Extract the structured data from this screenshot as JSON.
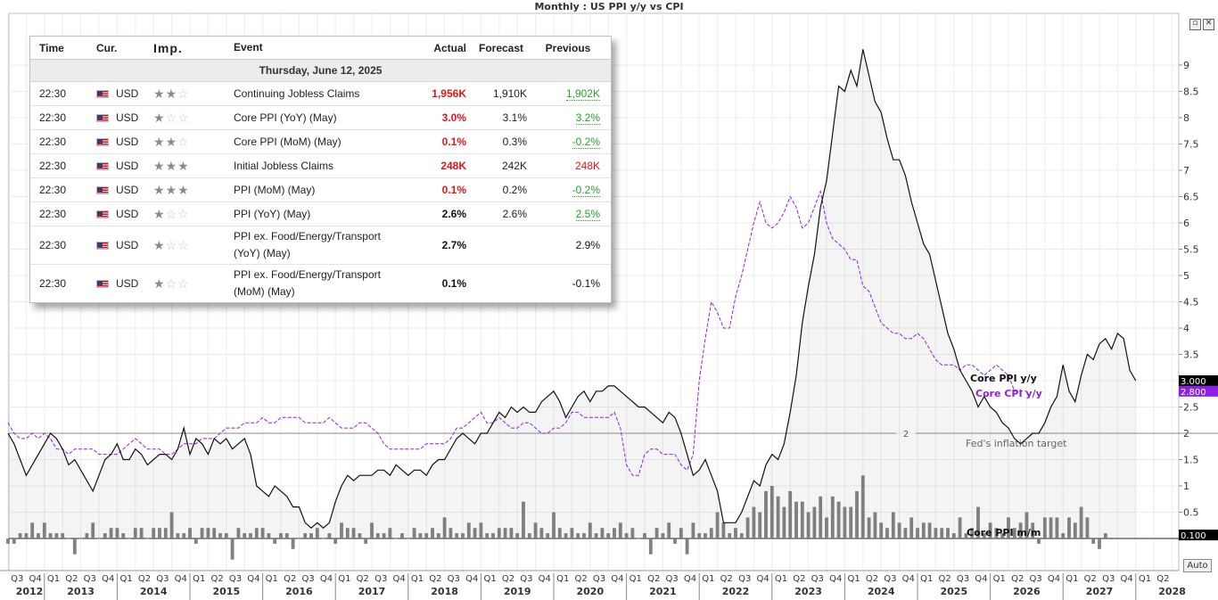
{
  "title": "Monthly : US PPI y/y vs CPI",
  "auto_label": "Auto",
  "calendar": {
    "headers": {
      "time": "Time",
      "cur": "Cur.",
      "imp": "Imp.",
      "event": "Event",
      "actual": "Actual",
      "forecast": "Forecast",
      "previous": "Previous"
    },
    "date": "Thursday, June 12, 2025",
    "rows": [
      {
        "time": "22:30",
        "cur": "USD",
        "stars": 2,
        "event": [
          "Continuing Jobless Claims"
        ],
        "actual": "1,956K",
        "actual_color": "red",
        "forecast": "1,910K",
        "previous": "1,902K",
        "previous_color": "green"
      },
      {
        "time": "22:30",
        "cur": "USD",
        "stars": 1,
        "event": [
          "Core PPI (YoY) (May)"
        ],
        "actual": "3.0%",
        "actual_color": "red",
        "forecast": "3.1%",
        "previous": "3.2%",
        "previous_color": "green"
      },
      {
        "time": "22:30",
        "cur": "USD",
        "stars": 2,
        "event": [
          "Core PPI (MoM) (May)"
        ],
        "actual": "0.1%",
        "actual_color": "red",
        "forecast": "0.3%",
        "previous": "-0.2%",
        "previous_color": "green"
      },
      {
        "time": "22:30",
        "cur": "USD",
        "stars": 3,
        "event": [
          "Initial Jobless Claims"
        ],
        "actual": "248K",
        "actual_color": "red",
        "forecast": "242K",
        "previous": "248K",
        "previous_color": "red"
      },
      {
        "time": "22:30",
        "cur": "USD",
        "stars": 3,
        "event": [
          "PPI (MoM) (May)"
        ],
        "actual": "0.1%",
        "actual_color": "red",
        "forecast": "0.2%",
        "previous": "-0.2%",
        "previous_color": "green"
      },
      {
        "time": "22:30",
        "cur": "USD",
        "stars": 1,
        "event": [
          "PPI (YoY) (May)"
        ],
        "actual": "2.6%",
        "actual_color": "black",
        "forecast": "2.6%",
        "previous": "2.5%",
        "previous_color": "green"
      },
      {
        "time": "22:30",
        "cur": "USD",
        "stars": 1,
        "event": [
          "PPI ex. Food/Energy/Transport",
          "(YoY) (May)"
        ],
        "actual": "2.7%",
        "actual_color": "black",
        "forecast": "",
        "previous": "2.9%",
        "previous_color": "black"
      },
      {
        "time": "22:30",
        "cur": "USD",
        "stars": 1,
        "event": [
          "PPI ex. Food/Energy/Transport",
          "(MoM) (May)"
        ],
        "actual": "0.1%",
        "actual_color": "black",
        "forecast": "",
        "previous": "-0.1%",
        "previous_color": "black"
      }
    ]
  },
  "chart_data": {
    "type": "line",
    "title": "Monthly : US PPI y/y vs CPI",
    "ylim": [
      -0.6,
      9.9
    ],
    "yticks": [
      "0.5",
      "1",
      "1.5",
      "2",
      "2.5",
      "3",
      "3.5",
      "4",
      "4.5",
      "5",
      "5.5",
      "6",
      "6.5",
      "7",
      "7.5",
      "8",
      "8.5",
      "9"
    ],
    "yticks_values": [
      0.5,
      1,
      1.5,
      2,
      2.5,
      3,
      3.5,
      4,
      4.5,
      5,
      5.5,
      6,
      6.5,
      7,
      7.5,
      8,
      8.5,
      9
    ],
    "x_quarter_labels": [
      "Q3",
      "Q4",
      "Q1",
      "Q2",
      "Q3",
      "Q4",
      "Q1",
      "Q2",
      "Q3",
      "Q4",
      "Q1",
      "Q2",
      "Q3",
      "Q4",
      "Q1",
      "Q2",
      "Q3",
      "Q4",
      "Q1",
      "Q2",
      "Q3",
      "Q4",
      "Q1",
      "Q2",
      "Q3",
      "Q4",
      "Q1",
      "Q2",
      "Q3",
      "Q4",
      "Q1",
      "Q2",
      "Q3",
      "Q4",
      "Q1",
      "Q2",
      "Q3",
      "Q4",
      "Q1",
      "Q2",
      "Q3",
      "Q4",
      "Q1",
      "Q2",
      "Q3",
      "Q4",
      "Q1",
      "Q2",
      "Q3",
      "Q4",
      "Q1",
      "Q2",
      "Q3",
      "Q4",
      "Q1",
      "Q2",
      "Q3",
      "Q4",
      "Q1",
      "Q2",
      "Q3",
      "Q4",
      "Q1",
      "Q2"
    ],
    "x_year_labels": [
      "2012",
      "2013",
      "2014",
      "2015",
      "2016",
      "2017",
      "2018",
      "2019",
      "2020",
      "2021",
      "2022",
      "2023",
      "2024",
      "2025",
      "2026",
      "2027",
      "2028"
    ],
    "x_start": "2012-07",
    "series": [
      {
        "name": "Core PPI y/y",
        "color": "#111111",
        "style": "solid",
        "last_value": "3.000",
        "values": [
          2.0,
          1.8,
          1.5,
          1.2,
          1.4,
          1.6,
          1.8,
          2.0,
          1.9,
          1.7,
          1.4,
          1.5,
          1.3,
          1.1,
          0.9,
          1.2,
          1.5,
          1.6,
          1.8,
          1.5,
          1.5,
          1.7,
          1.6,
          1.4,
          1.5,
          1.6,
          1.6,
          1.5,
          1.7,
          2.1,
          1.6,
          1.9,
          1.8,
          1.6,
          1.9,
          1.8,
          1.9,
          1.7,
          1.8,
          1.9,
          1.6,
          1.0,
          0.9,
          0.8,
          1.0,
          0.9,
          0.8,
          0.6,
          0.6,
          0.3,
          0.2,
          0.3,
          0.2,
          0.3,
          0.7,
          1.0,
          1.2,
          1.1,
          1.2,
          1.2,
          1.2,
          1.3,
          1.3,
          1.2,
          1.4,
          1.3,
          1.2,
          1.3,
          1.3,
          1.2,
          1.4,
          1.5,
          1.5,
          1.7,
          1.9,
          2.0,
          1.9,
          1.8,
          2.0,
          2.0,
          2.2,
          2.4,
          2.3,
          2.5,
          2.4,
          2.5,
          2.4,
          2.4,
          2.6,
          2.7,
          2.8,
          2.6,
          2.3,
          2.5,
          2.7,
          2.8,
          2.6,
          2.8,
          2.8,
          2.9,
          2.9,
          2.8,
          2.7,
          2.6,
          2.5,
          2.5,
          2.4,
          2.3,
          2.2,
          2.4,
          2.3,
          2.0,
          1.6,
          1.2,
          1.3,
          1.5,
          1.2,
          0.9,
          0.3,
          0.3,
          0.3,
          0.5,
          0.8,
          1.1,
          1.0,
          1.4,
          1.6,
          1.5,
          1.8,
          2.4,
          3.1,
          4.1,
          4.8,
          5.4,
          6.3,
          6.8,
          7.7,
          8.6,
          8.5,
          8.9,
          8.6,
          9.3,
          8.8,
          8.3,
          8.1,
          7.6,
          7.2,
          7.2,
          6.9,
          6.4,
          6.0,
          5.6,
          5.4,
          4.9,
          4.4,
          3.9,
          3.6,
          3.2,
          3.0,
          2.8,
          2.5,
          2.7,
          2.5,
          2.4,
          2.2,
          2.1,
          1.9,
          1.8,
          1.9,
          2.0,
          2.0,
          2.2,
          2.5,
          2.7,
          3.3,
          2.8,
          2.6,
          3.1,
          3.5,
          3.4,
          3.7,
          3.8,
          3.6,
          3.9,
          3.8,
          3.2,
          3.0
        ]
      },
      {
        "name": "Core CPI y/y",
        "color": "#8e1ee8",
        "style": "dashed",
        "last_value": "2.800",
        "values": [
          2.2,
          2.0,
          1.9,
          1.9,
          2.0,
          1.9,
          2.0,
          1.9,
          1.7,
          1.7,
          1.6,
          1.7,
          1.7,
          1.7,
          1.7,
          1.6,
          1.6,
          1.6,
          1.6,
          1.7,
          1.8,
          1.9,
          1.8,
          1.7,
          1.7,
          1.7,
          1.6,
          1.6,
          1.7,
          1.8,
          1.8,
          1.8,
          1.9,
          1.9,
          1.9,
          2.0,
          2.1,
          2.1,
          2.1,
          2.2,
          2.2,
          2.2,
          2.3,
          2.2,
          2.2,
          2.3,
          2.3,
          2.3,
          2.3,
          2.2,
          2.2,
          2.2,
          2.2,
          2.3,
          2.2,
          2.1,
          2.1,
          2.1,
          2.2,
          2.2,
          2.1,
          2.0,
          1.8,
          1.7,
          1.7,
          1.7,
          1.7,
          1.7,
          1.7,
          1.8,
          1.8,
          1.8,
          1.8,
          1.9,
          2.1,
          2.1,
          2.2,
          2.3,
          2.4,
          2.2,
          2.2,
          2.3,
          2.2,
          2.1,
          2.1,
          2.2,
          2.2,
          2.1,
          2.0,
          2.0,
          2.1,
          2.1,
          2.2,
          2.4,
          2.4,
          2.3,
          2.3,
          2.3,
          2.3,
          2.3,
          2.4,
          2.1,
          1.4,
          1.2,
          1.2,
          1.6,
          1.7,
          1.7,
          1.6,
          1.6,
          1.6,
          1.4,
          1.3,
          1.6,
          3.0,
          3.8,
          4.5,
          4.3,
          4.0,
          4.0,
          4.6,
          5.0,
          5.5,
          6.0,
          6.4,
          6.0,
          5.9,
          6.0,
          6.2,
          6.5,
          6.3,
          5.9,
          6.0,
          6.3,
          6.6,
          6.0,
          5.7,
          5.6,
          5.5,
          5.3,
          5.3,
          4.8,
          4.7,
          4.4,
          4.1,
          4.0,
          3.9,
          3.9,
          3.8,
          3.8,
          3.9,
          3.8,
          3.6,
          3.4,
          3.3,
          3.3,
          3.3,
          3.2,
          3.3,
          3.3,
          3.2,
          3.1,
          3.2,
          3.3,
          3.2,
          3.1,
          2.8,
          2.8,
          2.8
        ]
      },
      {
        "name": "Core PPI  m/m",
        "color": "#808080",
        "style": "bar",
        "last_value": "0.100",
        "values": [
          -0.1,
          -0.1,
          0.1,
          0.1,
          0.3,
          0.1,
          0.3,
          0.1,
          0.1,
          0.1,
          0.0,
          -0.3,
          0.0,
          0.1,
          0.3,
          0.0,
          0.1,
          0.2,
          0.2,
          0.1,
          0.0,
          0.2,
          0.2,
          0.0,
          0.2,
          0.2,
          0.2,
          0.5,
          0.1,
          0.1,
          0.2,
          -0.1,
          0.2,
          0.2,
          0.2,
          0.1,
          0.1,
          -0.4,
          0.2,
          0.1,
          0.1,
          0.2,
          0.2,
          0.1,
          -0.1,
          0.1,
          0.1,
          -0.2,
          0.0,
          0.1,
          0.1,
          0.2,
          0.0,
          0.1,
          -0.1,
          0.3,
          0.2,
          0.2,
          0.1,
          -0.1,
          0.3,
          0.1,
          0.1,
          0.2,
          0.0,
          0.1,
          0.0,
          0.2,
          0.1,
          0.1,
          0.2,
          0.1,
          0.4,
          0.2,
          0.1,
          0.1,
          0.3,
          0.2,
          0.3,
          0.1,
          0.1,
          0.2,
          0.2,
          0.2,
          0.1,
          0.7,
          0.1,
          0.3,
          0.2,
          0.1,
          0.5,
          0.2,
          0.1,
          0.2,
          0.1,
          0.1,
          0.3,
          0.1,
          0.2,
          0.1,
          0.2,
          0.3,
          0.1,
          0.2,
          0.0,
          0.1,
          -0.3,
          0.2,
          0.1,
          0.3,
          -0.1,
          0.2,
          -0.3,
          0.3,
          0.1,
          0.1,
          0.2,
          0.5,
          0.3,
          0.1,
          0.2,
          0.1,
          0.4,
          0.6,
          0.5,
          0.9,
          1.0,
          0.8,
          0.6,
          0.9,
          0.7,
          0.7,
          0.5,
          0.6,
          0.8,
          0.4,
          0.8,
          0.7,
          0.6,
          0.6,
          0.9,
          1.2,
          0.4,
          0.5,
          0.3,
          0.2,
          0.5,
          0.3,
          0.2,
          0.4,
          0.2,
          0.3,
          0.3,
          0.2,
          0.2,
          0.2,
          0.1,
          0.4,
          0.1,
          0.2,
          0.6,
          0.1,
          0.3,
          0.2,
          0.1,
          0.4,
          0.2,
          0.3,
          0.5,
          0.3,
          -0.1,
          0.4,
          0.4,
          0.4,
          0.1,
          0.4,
          0.3,
          0.6,
          0.4,
          -0.1,
          -0.2,
          0.1
        ]
      }
    ],
    "reference_line": {
      "value": 2,
      "label": "2",
      "annotation": "Fed's inflation target"
    },
    "grid": true
  }
}
